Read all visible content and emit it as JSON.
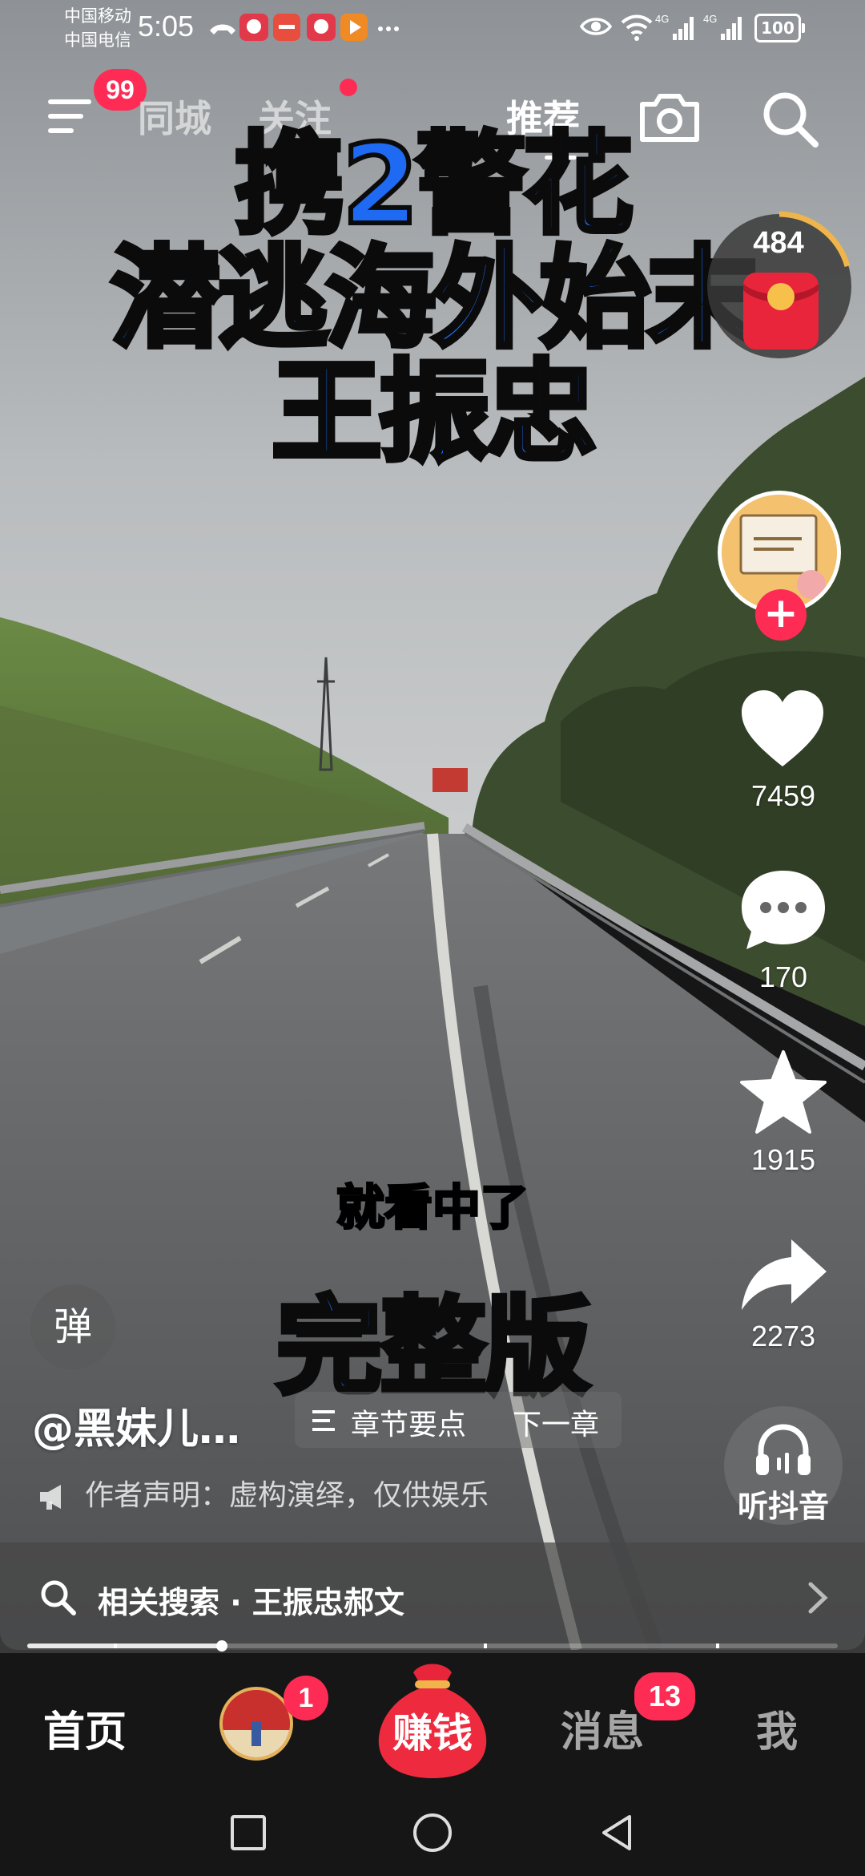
{
  "status_bar": {
    "carrier_1": "中国移动",
    "carrier_2": "中国电信",
    "time": "5:05",
    "battery": "100",
    "network_1": "4G",
    "network_2": "4G"
  },
  "top_nav": {
    "menu_badge": "99",
    "tabs": [
      {
        "label": "同城",
        "active": false
      },
      {
        "label": "关注",
        "active": false,
        "has_dot": true
      },
      {
        "label": "推荐",
        "active": true
      }
    ],
    "icons": [
      "camera-icon",
      "search-icon"
    ]
  },
  "video": {
    "title_lines": [
      "携2警花",
      "潜逃海外始末",
      "王振忠"
    ],
    "subtitle": "就看中了",
    "complete_label": "完整版",
    "danmu_label": "弹"
  },
  "red_packet": {
    "count": "484"
  },
  "right_rail": {
    "like_count": "7459",
    "comment_count": "170",
    "favorite_count": "1915",
    "share_count": "2273",
    "listen_label": "听抖音"
  },
  "author": {
    "name": "@黑妹儿…",
    "chapter_points": "章节要点",
    "next_chapter": "下一章",
    "declaration": "作者声明：虚构演绎，仅供娱乐"
  },
  "related_search": {
    "text": "相关搜索 · 王振忠郝文"
  },
  "progress": {
    "value": 0.24
  },
  "bottom_tabs": {
    "home": "首页",
    "mid_badge": "1",
    "earn": "赚钱",
    "messages": "消息",
    "messages_badge": "13",
    "me": "我"
  },
  "colors": {
    "accent_red": "#fe2c55",
    "title_blue": "#1e6af2"
  }
}
